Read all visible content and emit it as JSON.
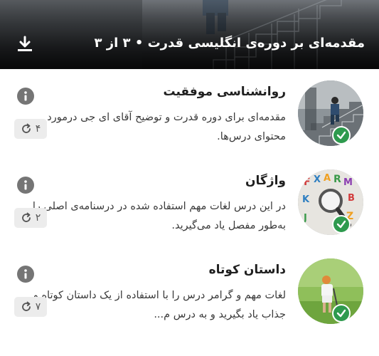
{
  "header": {
    "title": "مقدمه‌ای بر دوره‌ی انگلیسی قدرت • ۳ از ۳",
    "download_icon": "download-icon"
  },
  "lessons": [
    {
      "title": "روانشناسی موفقیت",
      "description": "مقدمه‌ای برای دوره قدرت و توضیح آقای ای جی درمورد محتوای درس‌ها.",
      "retry_count": "۴",
      "completed": true,
      "image": "man-climbing-stairs"
    },
    {
      "title": "واژگان",
      "description": "در این درس لغات مهم استفاده شده در درسنامه‌ی اصلی را به‌طور مفصل یاد می‌گیرید.",
      "retry_count": "۲",
      "completed": true,
      "image": "magnifier-letters"
    },
    {
      "title": "داستان کوتاه",
      "description": "لغات مهم و گرامر درس را با استفاده از یک داستان کوتاه و جذاب یاد بگیرید و به درس م...",
      "retry_count": "۷",
      "completed": true,
      "image": "golfer"
    }
  ],
  "colors": {
    "check": "#2e9a4e",
    "info": "#757575",
    "chip": "#ececec"
  }
}
